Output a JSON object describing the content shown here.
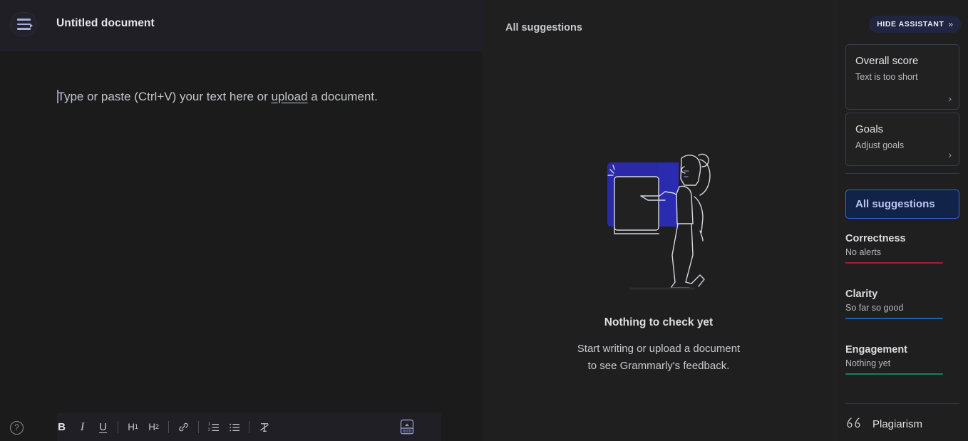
{
  "editor": {
    "menu_icon": "hamburger-menu-icon",
    "document_title": "Untitled document",
    "placeholder_before": "Type or paste (Ctrl+V) your text here or ",
    "placeholder_link": "upload",
    "placeholder_after": " a document.",
    "toolbar": {
      "help_label": "?",
      "bold_label": "B",
      "italic_label": "I",
      "underline_label": "U",
      "h1_label": "H",
      "h1_sub": "1",
      "h2_label": "H",
      "h2_sub": "2",
      "link_icon": "link-icon",
      "ordered_list_icon": "ordered-list-icon",
      "bullet_list_icon": "bullet-list-icon",
      "clear_format_icon": "clear-formatting-icon",
      "upload_icon": "upload-document-icon"
    }
  },
  "suggestions": {
    "title": "All suggestions",
    "illustration": "woman-pointing-at-document-illustration",
    "empty_title": "Nothing to check yet",
    "empty_sub_line1": "Start writing or upload a document",
    "empty_sub_line2": "to see Grammarly's feedback."
  },
  "assistant": {
    "hide_button_label": "HIDE ASSISTANT",
    "hide_button_icon": "double-chevron-right-icon",
    "overall_score": {
      "title": "Overall score",
      "subtitle": "Text is too short",
      "chevron": "›"
    },
    "goals": {
      "title": "Goals",
      "subtitle": "Adjust goals",
      "chevron": "›"
    },
    "all_suggestions_label": "All suggestions",
    "categories": [
      {
        "name": "Correctness",
        "status": "No alerts",
        "color": "#a31d3b"
      },
      {
        "name": "Clarity",
        "status": "So far so good",
        "color": "#1f5fa8"
      },
      {
        "name": "Engagement",
        "status": "Nothing yet",
        "color": "#1f7a52"
      }
    ],
    "plagiarism": {
      "label": "Plagiarism",
      "icon": "quotation-mark-icon"
    }
  },
  "theme": {
    "bg_dark": "#1b1b1b",
    "panel_bg": "#1f1f1f",
    "accent_blue": "#3e62d6",
    "accent_navy": "#12234a",
    "illustration_blue": "#2a2aa8"
  }
}
